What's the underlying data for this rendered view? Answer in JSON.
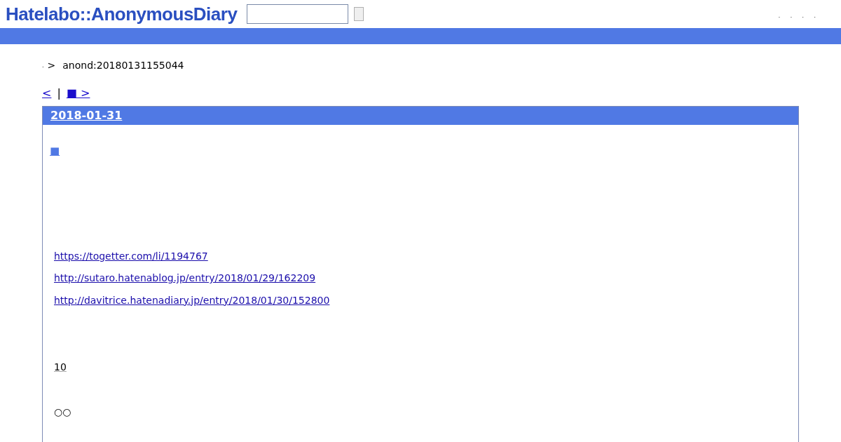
{
  "header": {
    "logo": "Hatelabo::AnonymousDiary",
    "top_links": [
      ".",
      ".",
      ".",
      "."
    ]
  },
  "breadcrumb": {
    "home": ".",
    "separator": ">",
    "current": "anond:20180131155044"
  },
  "pager": {
    "prev": "<",
    "separator": "|",
    "current": "■",
    "next": ">"
  },
  "day": {
    "date": "2018-01-31",
    "section_mark": "■",
    "body": [
      {
        "kind": "link",
        "text": "https://togetter.com/li/1194767"
      },
      {
        "kind": "link",
        "text": "http://sutaro.hatenablog.jp/entry/2018/01/29/162209"
      },
      {
        "kind": "link",
        "text": "http://davitrice.hatenadiary.jp/entry/2018/01/30/152800"
      },
      {
        "kind": "gap"
      },
      {
        "kind": "underlined",
        "text": "10"
      },
      {
        "kind": "plain",
        "text": "○○"
      }
    ]
  }
}
